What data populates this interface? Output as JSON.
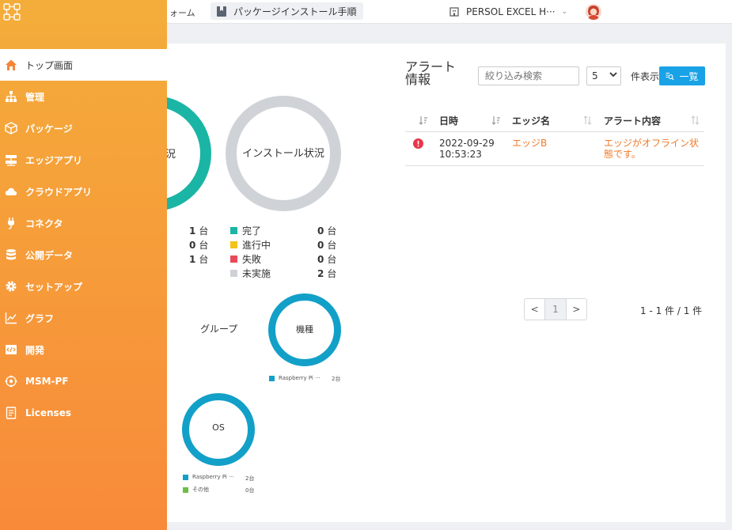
{
  "topbar": {
    "crumb_fragment": "ォーム",
    "package_tab": "パッケージインストール手順",
    "org_name": "PERSOL EXCEL H···",
    "org_caret": "⌄"
  },
  "sidebar": {
    "items": [
      {
        "label": "トップ画面",
        "icon": "home-icon"
      },
      {
        "label": "管理",
        "icon": "sitemap-icon"
      },
      {
        "label": "パッケージ",
        "icon": "box-icon"
      },
      {
        "label": "エッジアプリ",
        "icon": "server-icon"
      },
      {
        "label": "クラウドアプリ",
        "icon": "cloud-icon"
      },
      {
        "label": "コネクタ",
        "icon": "plug-icon"
      },
      {
        "label": "公開データ",
        "icon": "database-icon"
      },
      {
        "label": "セットアップ",
        "icon": "gear-icon"
      },
      {
        "label": "グラフ",
        "icon": "line-chart-icon"
      },
      {
        "label": "開発",
        "icon": "code-icon"
      },
      {
        "label": "MSM-PF",
        "icon": "network-icon"
      },
      {
        "label": "Licenses",
        "icon": "document-icon"
      }
    ]
  },
  "status_chart": {
    "label_fragment": "況",
    "counts": [
      "1",
      "0",
      "1"
    ],
    "unit": "台"
  },
  "install_chart": {
    "title": "インストール状況",
    "legend": [
      {
        "label": "完了",
        "count": "0",
        "color": "#1ab5a5"
      },
      {
        "label": "進行中",
        "count": "0",
        "color": "#f2c31a"
      },
      {
        "label": "失敗",
        "count": "0",
        "color": "#e84a5a"
      },
      {
        "label": "未実施",
        "count": "2",
        "color": "#cfd3d8"
      }
    ],
    "unit": "台"
  },
  "group_label": "グループ",
  "model_chart": {
    "title": "機種",
    "legend": [
      {
        "label": "Raspberry Pi ···",
        "count": "2台",
        "color": "#12a0c8"
      }
    ]
  },
  "os_chart": {
    "title": "OS",
    "legend": [
      {
        "label": "Raspberry Pi ···",
        "count": "2台",
        "color": "#12a0c8"
      },
      {
        "label": "その他",
        "count": "0台",
        "color": "#6cbd45"
      }
    ]
  },
  "alerts": {
    "title_line1": "アラート",
    "title_line2": "情報",
    "search_placeholder": "絞り込み検索",
    "page_size": "5",
    "per_page_label": "件表示",
    "list_button": "一覧",
    "columns": [
      "日時",
      "エッジ名",
      "アラート内容"
    ],
    "rows": [
      {
        "date": "2022-09-29",
        "time": "10:53:23",
        "edge": "エッジB",
        "content_line1": "エッジがオフライン状",
        "content_line2": "態です。"
      }
    ],
    "pager": {
      "prev": "<",
      "current": "1",
      "next": ">"
    },
    "page_info": "1 - 1 件 / 1 件"
  },
  "colors": {
    "sidebar_top": "#f4ad3a",
    "sidebar_bottom": "#f88a3a",
    "accent_blue": "#1aa2e6",
    "alert_text": "#f07a2a",
    "teal": "#1ab5a5"
  }
}
